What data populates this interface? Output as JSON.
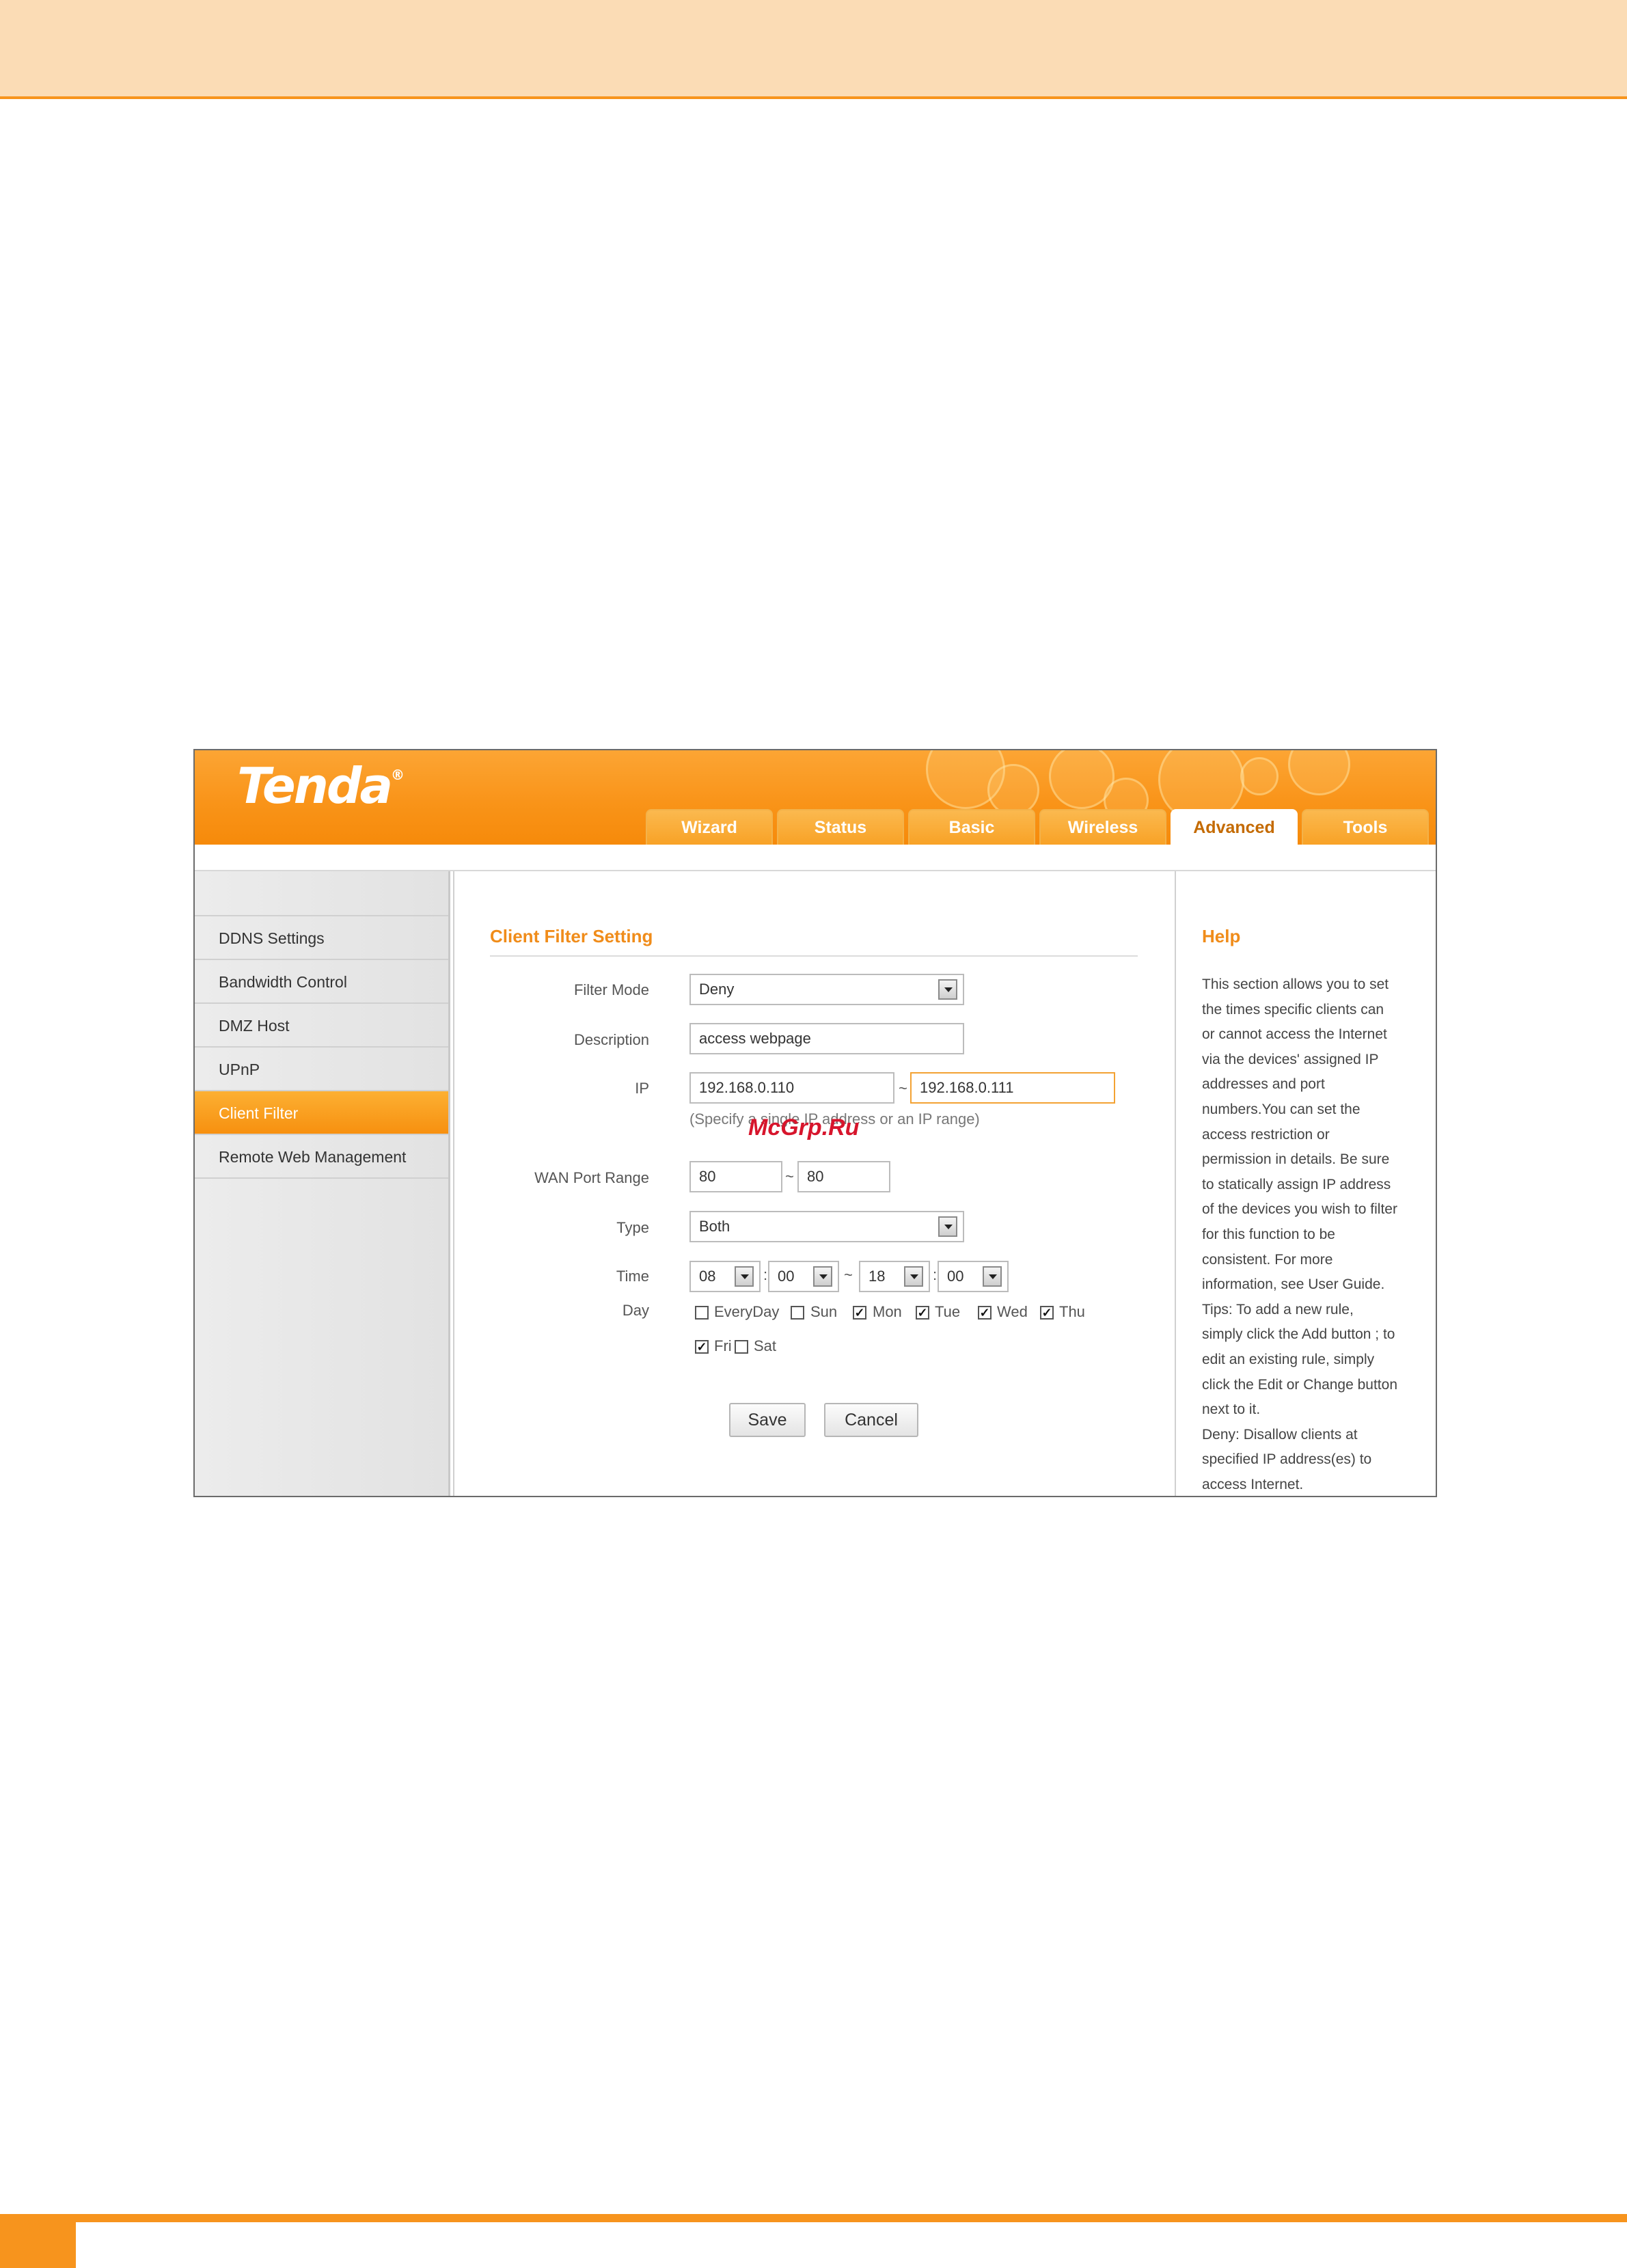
{
  "brand": {
    "logo": "Tenda",
    "registered_mark": "®"
  },
  "tabs": [
    {
      "label": "Wizard"
    },
    {
      "label": "Status"
    },
    {
      "label": "Basic"
    },
    {
      "label": "Wireless"
    },
    {
      "label": "Advanced",
      "active": true
    },
    {
      "label": "Tools"
    }
  ],
  "sidebar": {
    "items": [
      {
        "label": "DDNS Settings"
      },
      {
        "label": "Bandwidth Control"
      },
      {
        "label": "DMZ Host"
      },
      {
        "label": "UPnP"
      },
      {
        "label": "Client Filter",
        "active": true
      },
      {
        "label": "Remote Web Management"
      }
    ]
  },
  "form": {
    "title": "Client Filter Setting",
    "filter_mode": {
      "label": "Filter Mode",
      "value": "Deny"
    },
    "description": {
      "label": "Description",
      "value": "access webpage"
    },
    "ip": {
      "label": "IP",
      "start": "192.168.0.110",
      "separator": "~",
      "end": "192.168.0.111",
      "hint": "(Specify a single IP address or an IP range)"
    },
    "wan_port_range": {
      "label": "WAN Port Range",
      "start": "80",
      "separator": "~",
      "end": "80"
    },
    "type": {
      "label": "Type",
      "value": "Both"
    },
    "time": {
      "label": "Time",
      "start_hour": "08",
      "start_minute": "00",
      "separator": "~",
      "end_hour": "18",
      "end_minute": "00",
      "colon": ":"
    },
    "day": {
      "label": "Day",
      "options": [
        {
          "label": "EveryDay",
          "checked": false
        },
        {
          "label": "Sun",
          "checked": false
        },
        {
          "label": "Mon",
          "checked": true
        },
        {
          "label": "Tue",
          "checked": true
        },
        {
          "label": "Wed",
          "checked": true
        },
        {
          "label": "Thu",
          "checked": true
        },
        {
          "label": "Fri",
          "checked": true
        },
        {
          "label": "Sat",
          "checked": false
        }
      ]
    },
    "save_label": "Save",
    "cancel_label": "Cancel"
  },
  "watermark": "McGrp.Ru",
  "help": {
    "title": "Help",
    "text": "This section allows you to set\nthe times specific clients can\nor cannot access the Internet\nvia the devices' assigned IP\naddresses and port\nnumbers.You can set the\naccess restriction or\npermission in details. Be sure\nto statically assign IP address\nof the devices you wish to filter\nfor this function to be\nconsistent. For more\ninformation, see User Guide.\nTips: To add a new rule,\nsimply click the Add button ; to\nedit an existing rule, simply\nclick the Edit or Change button\nnext to it.\nDeny: Disallow clients at\nspecified IP address(es) to\naccess Internet."
  },
  "colors": {
    "accent": "#f7941d",
    "page_header": "#fbdcb5",
    "section_title": "#f08c1a"
  }
}
